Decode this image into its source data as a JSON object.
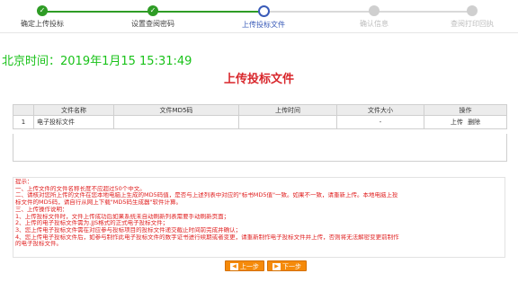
{
  "steps": [
    {
      "label": "确定上传投标",
      "state": "done"
    },
    {
      "label": "设置查阅密码",
      "state": "done"
    },
    {
      "label": "上传投标文件",
      "state": "current"
    },
    {
      "label": "确认信息",
      "state": "pending"
    },
    {
      "label": "查阅打印回执",
      "state": "pending"
    }
  ],
  "colors": {
    "done": "#2e9c25",
    "current": "#3a5bb8",
    "pending": "#cfcfcf",
    "clock": "#19c219",
    "title": "#d8262b",
    "notes": "#e02020",
    "button": "#f58a0a"
  },
  "clock": {
    "text": "北京时间：2019年1月15 15:31:49"
  },
  "page_title": "上传投标文件",
  "table": {
    "headers": [
      "",
      "文件名称",
      "文件MD5码",
      "上传时间",
      "文件大小",
      "操作"
    ],
    "rows": [
      {
        "index": "1",
        "name": "电子投标文件",
        "md5": "",
        "time": "",
        "size": "-",
        "upload": "上传",
        "delete": "删除"
      }
    ]
  },
  "notes": [
    "提示：",
    "一、上传文件的文件名称长度不应超过50个中文。",
    "二、请核对您所上传的文件在您本地电脑上生成的MD5码值，是否与上述列表中对应的\"标书MD5值\"一致。如果不一致，请重新上传。本地电脑上投",
    "标文件的MD5码，请自行从网上下载\"MD5码生成器\"软件计算。",
    "三、上传操作说明：",
    "1、上传投标文件时，文件上传成功后如果系统未自动刷新列表需要手动刷新页面；",
    "2、上传的电子投标文件需为.JJS格式的正式电子投标文件；",
    "3、您上传电子投标文件需在对应参与投标项目的投标文件递交截止时间前完成并确认；",
    "4、您上传电子投标文件后，如参与制作此电子投标文件的数字证书进行续期或者变更，请重新制作电子投标文件并上传，否则将无法解密变更前制作",
    "的电子投标文件。"
  ],
  "buttons": {
    "prev": "上一步",
    "next": "下一步"
  },
  "icons": {
    "check": "check-icon",
    "arrow": "arrow-left-icon"
  }
}
